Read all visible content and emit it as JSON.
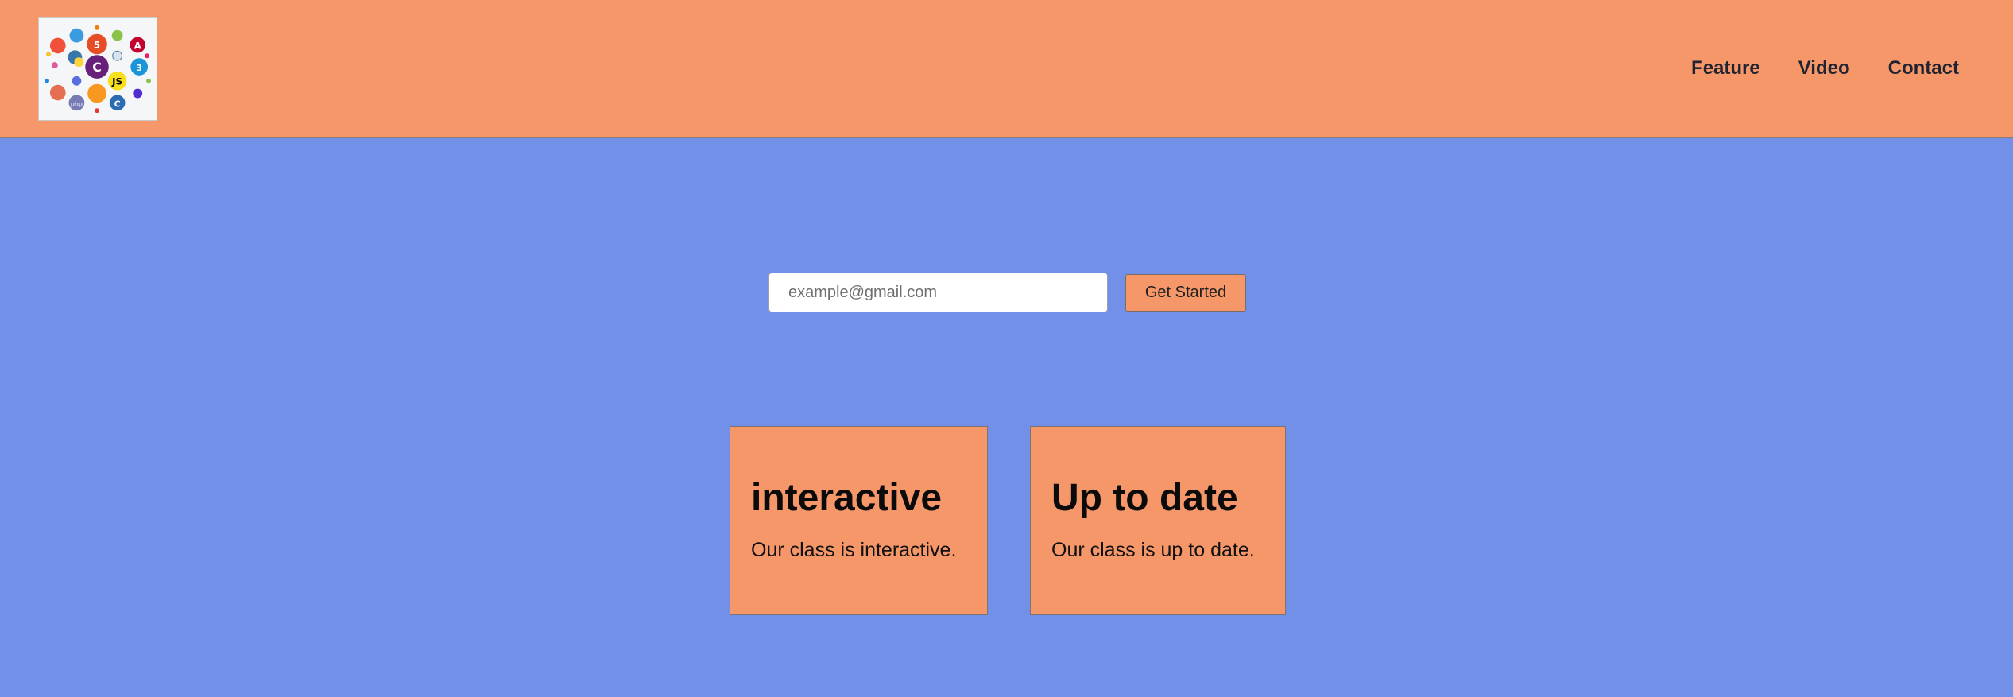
{
  "header": {
    "logo_icons": [
      "swift-icon",
      "redux-icon",
      "html5-icon",
      "android-icon",
      "angular-icon",
      "python-icon",
      "csharp-icon",
      "mysql-icon",
      "css3-icon",
      "javascript-icon",
      "java-icon",
      "php-icon",
      "c-icon",
      "ruby-icon",
      "dotnet-icon"
    ],
    "nav": {
      "items": [
        {
          "label": "Feature"
        },
        {
          "label": "Video"
        },
        {
          "label": "Contact"
        }
      ]
    }
  },
  "signup": {
    "email_placeholder": "example@gmail.com",
    "email_value": "",
    "button_label": "Get Started"
  },
  "features": {
    "cards": [
      {
        "title": "interactive",
        "text": "Our class is interactive."
      },
      {
        "title": "Up to date",
        "text": "Our class is up to date."
      }
    ]
  },
  "colors": {
    "header_bg": "#f6976a",
    "page_bg": "#7290e8",
    "accent": "#f6976a"
  }
}
